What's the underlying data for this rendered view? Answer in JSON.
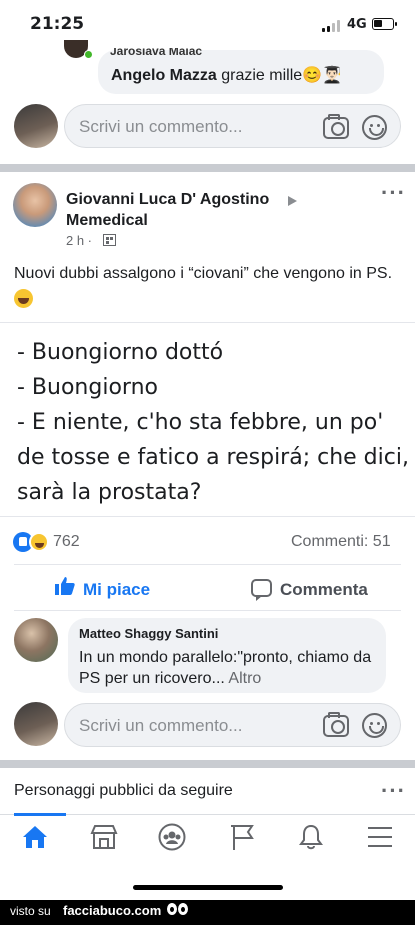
{
  "status_bar": {
    "time": "21:25",
    "network": "4G"
  },
  "top_reply": {
    "cut_author": "Jarosiava Maiac",
    "author": "Angelo Mazza",
    "text": "grazie mille😊👨🏻‍🎓"
  },
  "comment_input": {
    "placeholder": "Scrivi un commento..."
  },
  "post": {
    "author": "Giovanni Luca D' Agostino",
    "target": "Memedical",
    "time": "2 h ·",
    "text": "Nuovi dubbi assalgono i “ciovani” che vengono in PS.",
    "content_lines": [
      "- Buongiorno dottó",
      "- Buongiorno",
      "- E niente, c'ho sta febbre, un po' de tosse e fatico a respirá; che dici, sarà la prostata?"
    ],
    "reactions_count": "762",
    "comments_count": "Commenti: 51",
    "like_label": "Mi piace",
    "comment_label": "Commenta",
    "menu_icon": "more-dots-icon"
  },
  "comment": {
    "author": "Matteo Shaggy Santini",
    "text": "In un mondo parallelo:\"pronto, chiamo da  PS per un ricovero...",
    "more": "Altro"
  },
  "suggestions": {
    "title": "Personaggi pubblici da seguire"
  },
  "tabs": [
    "home-icon",
    "marketplace-icon",
    "groups-icon",
    "pages-flag-icon",
    "notifications-bell-icon",
    "menu-icon"
  ],
  "footer": {
    "prefix": "visto su",
    "brand": "facciabuco.com"
  },
  "colors": {
    "accent": "#1877f2",
    "separator": "#c9ccd1",
    "bubble": "#f0f2f5"
  }
}
